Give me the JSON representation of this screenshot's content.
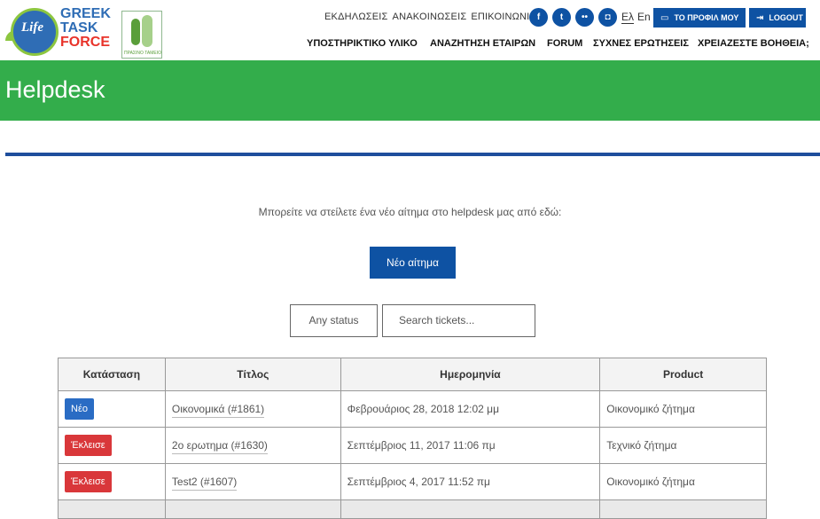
{
  "logo": {
    "life": "Life",
    "lines": [
      "GREEK",
      "TASK",
      "FORCE"
    ],
    "secondary_caption": "ΠΡΑΣΙΝΟ ΤΑΜΕΙΟ"
  },
  "top_links": [
    "ΕΚΔΗΛΩΣΕΙΣ",
    "ΑΝΑΚΟΙΝΩΣΕΙΣ",
    "ΕΠΙΚΟΙΝΩΝΙΑ"
  ],
  "social_icons": [
    "facebook-icon",
    "twitter-icon",
    "flickr-icon",
    "instagram-icon"
  ],
  "languages": {
    "el": "Ελ",
    "en": "En"
  },
  "header_buttons": {
    "profile": "ΤΟ ΠΡΟΦΙΛ ΜΟΥ",
    "logout": "LOGOUT"
  },
  "main_nav": [
    "ΥΠΟΣΤΗΡΙΚΤΙΚΟ ΥΛΙΚΟ",
    "ΑΝΑΖΗΤΗΣΗ ΕΤΑΙΡΩΝ",
    "FORUM",
    "ΣΥΧΝΕΣ ΕΡΩΤΗΣΕΙΣ",
    "ΧΡΕΙΑΖΕΣΤΕ ΒΟΗΘΕΙΑ;"
  ],
  "page_title": "Helpdesk",
  "intro_text": "Μπορείτε να στείλετε ένα νέο αίτημα στο helpdesk μας από εδώ:",
  "new_request_button": "Νέο αίτημα",
  "status_filter": "Any status",
  "search": {
    "placeholder": "Search tickets..."
  },
  "table": {
    "headers": [
      "Κατάσταση",
      "Τίτλος",
      "Ημερομηνία",
      "Product"
    ],
    "rows": [
      {
        "status": "Νέο",
        "title": "Οικονομικά (#1861)",
        "date": "Φεβρουάριος 28, 2018 12:02 μμ",
        "product": "Οικονομικό ζήτημα"
      },
      {
        "status": "Έκλεισε",
        "title": "2ο ερωτημα (#1630)",
        "date": "Σεπτέμβριος 11, 2017 11:06 πμ",
        "product": "Τεχνικό ζήτημα"
      },
      {
        "status": "Έκλεισε",
        "title": "Test2 (#1607)",
        "date": "Σεπτέμβριος 4, 2017 11:52 πμ",
        "product": "Οικονομικό ζήτημα"
      }
    ]
  },
  "colors": {
    "brand_blue": "#0e52a3",
    "banner_green": "#33ad4b",
    "status_new": "#2a6cc4",
    "status_closed": "#d9373a"
  }
}
